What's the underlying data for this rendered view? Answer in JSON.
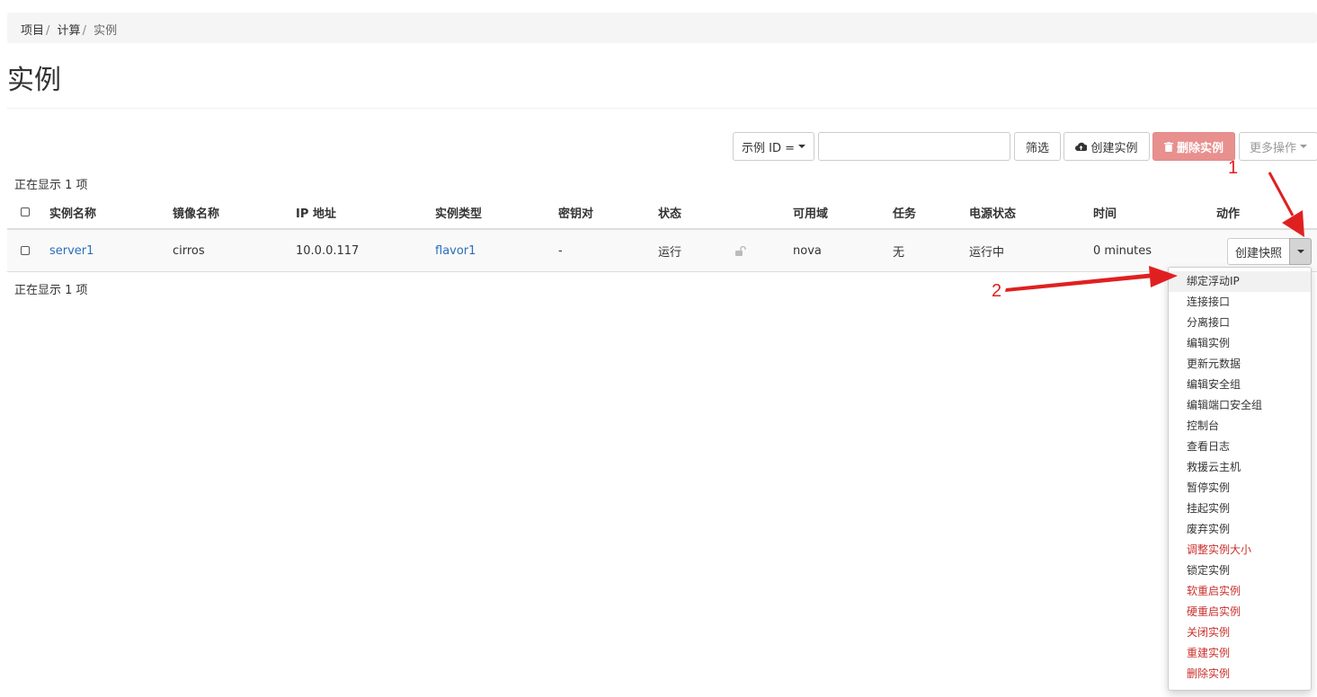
{
  "breadcrumb": {
    "items": [
      "项目",
      "计算"
    ],
    "active": "实例",
    "separator": "/"
  },
  "page": {
    "title": "实例"
  },
  "toolbar": {
    "filter_type_label": "示例 ID =",
    "filter_input_value": "",
    "filter_button": "筛选",
    "create_button": "创建实例",
    "delete_button": "删除实例",
    "more_button": "更多操作"
  },
  "summary": {
    "top": "正在显示 1 项",
    "bottom": "正在显示 1 项"
  },
  "table": {
    "headers": {
      "name": "实例名称",
      "image": "镜像名称",
      "ip": "IP 地址",
      "flavor": "实例类型",
      "keypair": "密钥对",
      "status": "状态",
      "az": "可用域",
      "task": "任务",
      "power": "电源状态",
      "time": "时间",
      "actions": "动作"
    },
    "rows": [
      {
        "name": "server1",
        "image": "cirros",
        "ip": "10.0.0.117",
        "flavor": "flavor1",
        "keypair": "-",
        "status": "运行",
        "az": "nova",
        "task": "无",
        "power": "运行中",
        "time": "0 minutes",
        "action_button": "创建快照"
      }
    ]
  },
  "dropdown": {
    "items": [
      {
        "label": "绑定浮动IP",
        "danger": false
      },
      {
        "label": "连接接口",
        "danger": false
      },
      {
        "label": "分离接口",
        "danger": false
      },
      {
        "label": "编辑实例",
        "danger": false
      },
      {
        "label": "更新元数据",
        "danger": false
      },
      {
        "label": "编辑安全组",
        "danger": false
      },
      {
        "label": "编辑端口安全组",
        "danger": false
      },
      {
        "label": "控制台",
        "danger": false
      },
      {
        "label": "查看日志",
        "danger": false
      },
      {
        "label": "救援云主机",
        "danger": false
      },
      {
        "label": "暂停实例",
        "danger": false
      },
      {
        "label": "挂起实例",
        "danger": false
      },
      {
        "label": "废弃实例",
        "danger": false
      },
      {
        "label": "调整实例大小",
        "danger": true
      },
      {
        "label": "锁定实例",
        "danger": false
      },
      {
        "label": "软重启实例",
        "danger": true
      },
      {
        "label": "硬重启实例",
        "danger": true
      },
      {
        "label": "关闭实例",
        "danger": true
      },
      {
        "label": "重建实例",
        "danger": true
      },
      {
        "label": "删除实例",
        "danger": true
      }
    ]
  },
  "annotations": {
    "step1": "1",
    "step2": "2"
  },
  "colors": {
    "link": "#2a6ebb",
    "danger": "#c9302c",
    "delete_button_bg": "#e8908e",
    "annotation": "#e02020"
  },
  "icons": {
    "create": "cloud-upload-icon",
    "delete": "trash-icon",
    "status_lock": "unlock-icon",
    "toggle": "caret-down-icon"
  }
}
